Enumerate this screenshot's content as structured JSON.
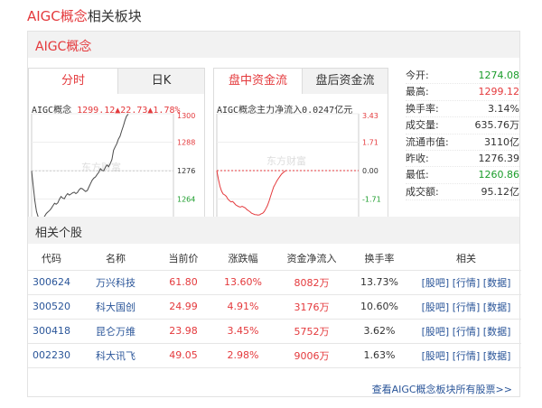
{
  "page_title": {
    "red": "AIGC概念",
    "dark": "相关板块"
  },
  "panel": {
    "title": "AIGC概念"
  },
  "tabs_left": [
    {
      "label": "分时"
    },
    {
      "label": "日K"
    }
  ],
  "tabs_right": [
    {
      "label": "盘中资金流"
    },
    {
      "label": "盘后资金流"
    }
  ],
  "intraday": {
    "title_name": "AIGC概念",
    "title_values": "1299.12▲22.73▲1.78%",
    "y_ticks": [
      "1300",
      "1288",
      "1276",
      "1264",
      "1253"
    ],
    "watermark": "东方财富",
    "prices": [
      1276.4,
      1270.1,
      1264.0,
      1259.6,
      1257.3,
      1256.0,
      1256.2,
      1256.6,
      1257.7,
      1258.8,
      1259.4,
      1260.0,
      1260.9,
      1262.0,
      1263.0,
      1262.6,
      1263.2,
      1264.7,
      1265.8,
      1265.1,
      1264.9,
      1266.2,
      1267.0,
      1266.4,
      1266.8,
      1267.3,
      1267.6,
      1267.0,
      1267.5,
      1268.6,
      1269.2,
      1269.0,
      1268.4,
      1267.9,
      1268.3,
      1269.8,
      1271.2,
      1272.6,
      1273.4,
      1273.9,
      1274.9,
      1275.8,
      1277.3,
      1276.6,
      1276.4,
      1277.8,
      1278.8,
      1278.1,
      1279.4,
      1281.1,
      1284.9,
      1286.3,
      1287.6,
      1289.5,
      1290.7,
      1292.9,
      1295.0,
      1297.3,
      1299.1,
      1299.8
    ],
    "ylim": [
      1253,
      1300
    ],
    "baseline": 1276.39
  },
  "fundflow": {
    "title_text": "AIGC概念主力净流入0.0247亿元",
    "y_ticks": [
      "3.43",
      "1.71",
      "0.00",
      "-1.71",
      "-3.43"
    ],
    "watermark": "东方财富",
    "values": [
      0.0,
      -0.52,
      -0.95,
      -1.24,
      -1.41,
      -1.47,
      -1.55,
      -1.72,
      -1.81,
      -1.89,
      -1.86,
      -1.96,
      -2.07,
      -2.13,
      -2.18,
      -2.2,
      -2.15,
      -2.2,
      -2.25,
      -2.35,
      -2.42,
      -2.48,
      -2.57,
      -2.61,
      -2.65,
      -2.66,
      -2.68,
      -2.67,
      -2.61,
      -2.57,
      -2.47,
      -2.3,
      -2.12,
      -1.85,
      -1.55,
      -1.25,
      -0.98,
      -0.8,
      -0.62,
      -0.47,
      -0.34,
      -0.2,
      -0.12,
      -0.05,
      0.02
    ],
    "ylim": [
      -3.43,
      3.43
    ]
  },
  "stats": [
    {
      "label": "今开:",
      "value": "1274.08",
      "color": "green"
    },
    {
      "label": "最高:",
      "value": "1299.12",
      "color": "red"
    },
    {
      "label": "换手率:",
      "value": "3.14%",
      "color": "dark"
    },
    {
      "label": "成交量:",
      "value": "635.76万",
      "color": "dark"
    },
    {
      "label": "流通市值:",
      "value": "3110亿",
      "color": "dark"
    },
    {
      "label": "昨收:",
      "value": "1276.39",
      "color": "dark"
    },
    {
      "label": "最低:",
      "value": "1260.86",
      "color": "green"
    },
    {
      "label": "成交额:",
      "value": "95.12亿",
      "color": "dark"
    }
  ],
  "related_title": "相关个股",
  "table": {
    "headers": [
      "代码",
      "名称",
      "当前价",
      "涨跌幅",
      "资金净流入",
      "换手率",
      "相关"
    ],
    "rows": [
      {
        "code": "300624",
        "name": "万兴科技",
        "price": "61.80",
        "change": "13.60%",
        "inflow": "8082万",
        "turnover": "13.73%"
      },
      {
        "code": "300520",
        "name": "科大国创",
        "price": "24.99",
        "change": "4.91%",
        "inflow": "3176万",
        "turnover": "10.60%"
      },
      {
        "code": "300418",
        "name": "昆仑万维",
        "price": "23.98",
        "change": "3.45%",
        "inflow": "5752万",
        "turnover": "3.62%"
      },
      {
        "code": "002230",
        "name": "科大讯飞",
        "price": "49.05",
        "change": "2.98%",
        "inflow": "9006万",
        "turnover": "1.63%"
      }
    ],
    "links": {
      "guba": "[股吧]",
      "quote": "[行情]",
      "data": "[数据]"
    }
  },
  "more_link": "查看AIGC概念板块所有股票>>",
  "colors": {
    "accent": "#e4393c",
    "up": "#e4393c",
    "down": "#1a9c2a",
    "link": "#2a5599"
  }
}
